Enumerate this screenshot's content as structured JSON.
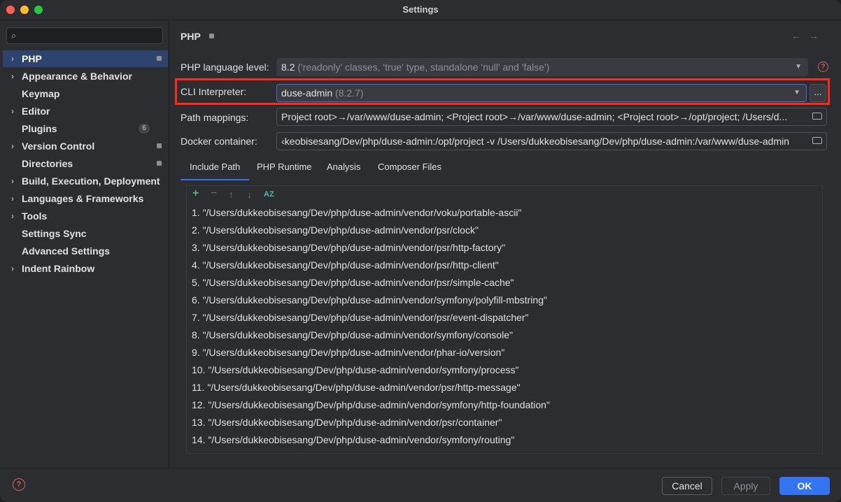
{
  "window": {
    "title": "Settings"
  },
  "sidebar": {
    "search_placeholder": "",
    "items": [
      {
        "label": "PHP",
        "arrow": "›",
        "selected": true
      },
      {
        "label": "Appearance & Behavior",
        "arrow": "›"
      },
      {
        "label": "Keymap",
        "arrow": ""
      },
      {
        "label": "Editor",
        "arrow": "›"
      },
      {
        "label": "Plugins",
        "arrow": "",
        "badge": "6"
      },
      {
        "label": "Version Control",
        "arrow": "›"
      },
      {
        "label": "Directories",
        "arrow": ""
      },
      {
        "label": "Build, Execution, Deployment",
        "arrow": "›"
      },
      {
        "label": "Languages & Frameworks",
        "arrow": "›"
      },
      {
        "label": "Tools",
        "arrow": "›"
      },
      {
        "label": "Settings Sync",
        "arrow": ""
      },
      {
        "label": "Advanced Settings",
        "arrow": ""
      },
      {
        "label": "Indent Rainbow",
        "arrow": "›"
      }
    ]
  },
  "main": {
    "title": "PHP",
    "back_arrow": "←",
    "forward_arrow": "→",
    "language_level": {
      "label": "PHP language level:",
      "value": "8.2",
      "hint": "('readonly' classes, 'true' type, standalone 'null' and 'false')"
    },
    "cli_interpreter": {
      "label": "CLI Interpreter:",
      "value": "duse-admin",
      "hint": "(8.2.7)",
      "more_button": "..."
    },
    "path_mappings": {
      "label": "Path mappings:",
      "value": "Project root>→/var/www/duse-admin; <Project root>→/var/www/duse-admin; <Project root>→/opt/project; /Users/d..."
    },
    "docker_container": {
      "label": "Docker container:",
      "value": "‹keobisesang/Dev/php/duse-admin:/opt/project -v /Users/dukkeobisesang/Dev/php/duse-admin:/var/www/duse-admin"
    },
    "tabs": [
      "Include Path",
      "PHP Runtime",
      "Analysis",
      "Composer Files"
    ],
    "toolbar": {
      "add": "+",
      "remove": "−",
      "up": "↑",
      "down": "↓",
      "sort": "AZ"
    },
    "include_paths": [
      "1. \"/Users/dukkeobisesang/Dev/php/duse-admin/vendor/voku/portable-ascii\"",
      "2. \"/Users/dukkeobisesang/Dev/php/duse-admin/vendor/psr/clock\"",
      "3. \"/Users/dukkeobisesang/Dev/php/duse-admin/vendor/psr/http-factory\"",
      "4. \"/Users/dukkeobisesang/Dev/php/duse-admin/vendor/psr/http-client\"",
      "5. \"/Users/dukkeobisesang/Dev/php/duse-admin/vendor/psr/simple-cache\"",
      "6. \"/Users/dukkeobisesang/Dev/php/duse-admin/vendor/symfony/polyfill-mbstring\"",
      "7. \"/Users/dukkeobisesang/Dev/php/duse-admin/vendor/psr/event-dispatcher\"",
      "8. \"/Users/dukkeobisesang/Dev/php/duse-admin/vendor/symfony/console\"",
      "9. \"/Users/dukkeobisesang/Dev/php/duse-admin/vendor/phar-io/version\"",
      "10. \"/Users/dukkeobisesang/Dev/php/duse-admin/vendor/symfony/process\"",
      "11. \"/Users/dukkeobisesang/Dev/php/duse-admin/vendor/psr/http-message\"",
      "12. \"/Users/dukkeobisesang/Dev/php/duse-admin/vendor/symfony/http-foundation\"",
      "13. \"/Users/dukkeobisesang/Dev/php/duse-admin/vendor/psr/container\"",
      "14. \"/Users/dukkeobisesang/Dev/php/duse-admin/vendor/symfony/routing\""
    ]
  },
  "footer": {
    "help": "?",
    "cancel": "Cancel",
    "apply": "Apply",
    "ok": "OK"
  },
  "colors": {
    "accent": "#3574f0",
    "selection": "#2e436e",
    "highlight_box": "#ff2a1a",
    "background": "#2b2d30"
  }
}
